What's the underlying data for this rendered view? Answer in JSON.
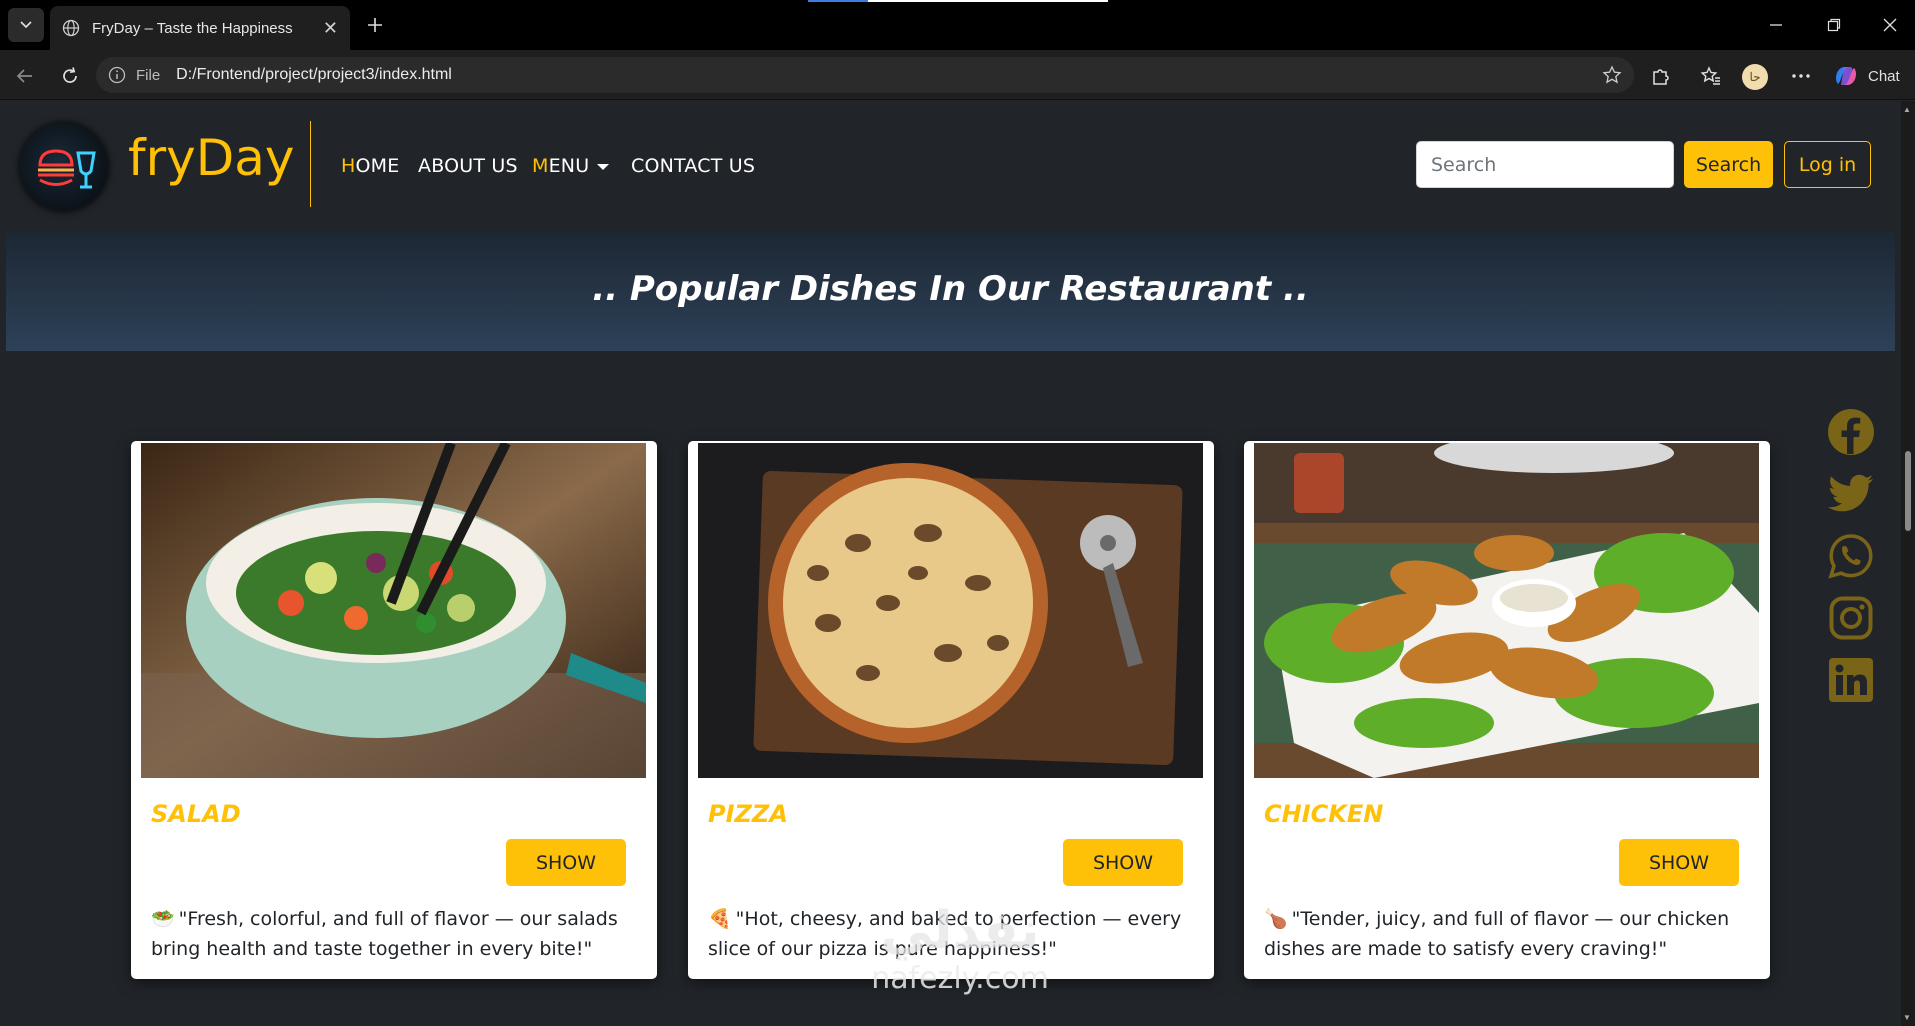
{
  "browser": {
    "tab_title": "FryDay – Taste the Happiness",
    "address_label": "File",
    "url": "D:/Frontend/project/project3/index.html",
    "profile_initial": "حا",
    "chat_label": "Chat"
  },
  "navbar": {
    "brand": "fryDay",
    "links": [
      {
        "first": "H",
        "rest": "OME"
      },
      {
        "first": "",
        "rest": "ABOUT US"
      },
      {
        "first": "M",
        "rest": "ENU"
      },
      {
        "first": "",
        "rest": "CONTACT US"
      }
    ],
    "search_placeholder": "Search",
    "search_button": "Search",
    "login_button": "Log in",
    "accent": "#ffc107"
  },
  "section": {
    "heading": ".. Popular Dishes In Our Restaurant .."
  },
  "dishes": [
    {
      "title": "SALAD",
      "button": "SHOW",
      "emoji": "🥗",
      "text": "\"Fresh, colorful, and full of flavor — our salads bring health and taste together in every bite!\""
    },
    {
      "title": "PIZZA",
      "button": "SHOW",
      "emoji": "🍕",
      "text": "\"Hot, cheesy, and baked to perfection — every slice of our pizza is pure happiness!\""
    },
    {
      "title": "CHICKEN",
      "button": "SHOW",
      "emoji": "🍗",
      "text": "\"Tender, juicy, and full of flavor — our chicken dishes are made to satisfy every craving!\""
    }
  ],
  "social_icons": [
    "facebook-icon",
    "twitter-icon",
    "whatsapp-icon",
    "instagram-icon",
    "linkedin-icon"
  ],
  "watermark": {
    "arabic": "نفذلي",
    "latin": "nafezly.com"
  },
  "colors": {
    "page_bg": "#212529",
    "accent": "#ffc107",
    "social_icon": "#7a6418"
  }
}
